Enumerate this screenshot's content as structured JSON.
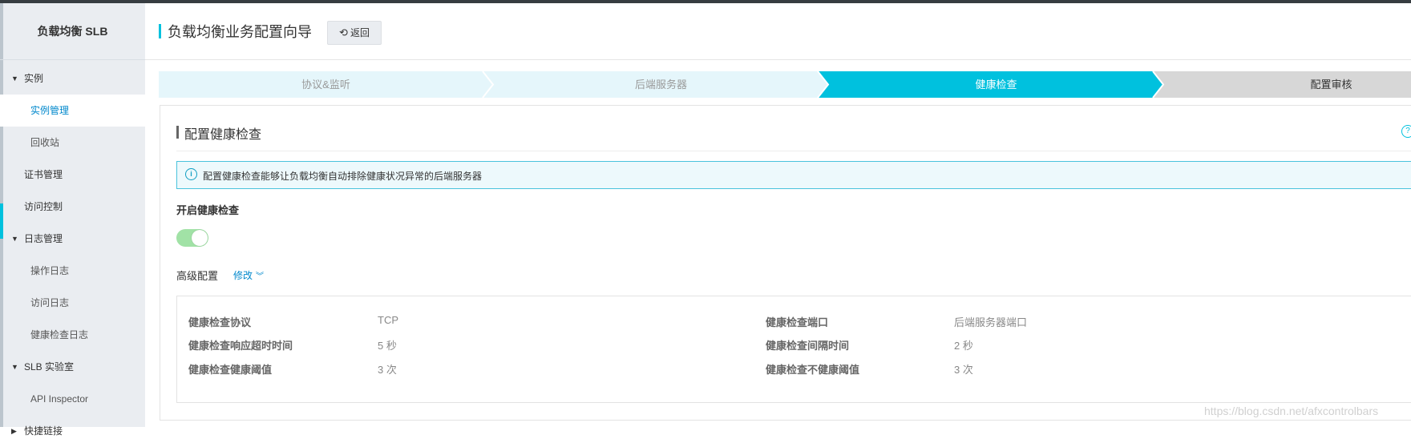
{
  "sidebar": {
    "title": "负载均衡 SLB",
    "items": [
      {
        "label": "实例",
        "kind": "group"
      },
      {
        "label": "实例管理",
        "kind": "sub",
        "active": true
      },
      {
        "label": "回收站",
        "kind": "sub"
      },
      {
        "label": "证书管理",
        "kind": "top"
      },
      {
        "label": "访问控制",
        "kind": "top"
      },
      {
        "label": "日志管理",
        "kind": "group"
      },
      {
        "label": "操作日志",
        "kind": "sub"
      },
      {
        "label": "访问日志",
        "kind": "sub"
      },
      {
        "label": "健康检查日志",
        "kind": "sub"
      },
      {
        "label": "SLB 实验室",
        "kind": "group"
      },
      {
        "label": "API Inspector",
        "kind": "sub"
      },
      {
        "label": "快捷链接",
        "kind": "group"
      }
    ]
  },
  "header": {
    "title": "负载均衡业务配置向导",
    "back_label": "返回",
    "back_icon": "undo-icon"
  },
  "steps": [
    {
      "label": "协议&监听",
      "state": "done"
    },
    {
      "label": "后端服务器",
      "state": "done"
    },
    {
      "label": "健康检查",
      "state": "active"
    },
    {
      "label": "配置审核",
      "state": "todo"
    }
  ],
  "card": {
    "title": "配置健康检查",
    "info": "配置健康检查能够让负载均衡自动排除健康状况异常的后端服务器",
    "enable_label": "开启健康检查",
    "enabled": true,
    "advanced_label": "高级配置",
    "edit_label": "修改",
    "config": [
      {
        "key": "健康检查协议",
        "value": "TCP"
      },
      {
        "key": "健康检查端口",
        "value": "后端服务器端口"
      },
      {
        "key": "健康检查响应超时时间",
        "value": "5 秒"
      },
      {
        "key": "健康检查间隔时间",
        "value": "2 秒"
      },
      {
        "key": "健康检查健康阈值",
        "value": "3 次"
      },
      {
        "key": "健康检查不健康阈值",
        "value": "3 次"
      }
    ]
  },
  "watermark": "https://blog.csdn.net/afxcontrolbars",
  "colors": {
    "accent": "#00c1de",
    "step_done": "#e5f6fb",
    "step_active": "#00c1de",
    "step_todo": "#d7d7d7",
    "toggle_on": "#a1e2a6",
    "link": "#0088cc"
  }
}
